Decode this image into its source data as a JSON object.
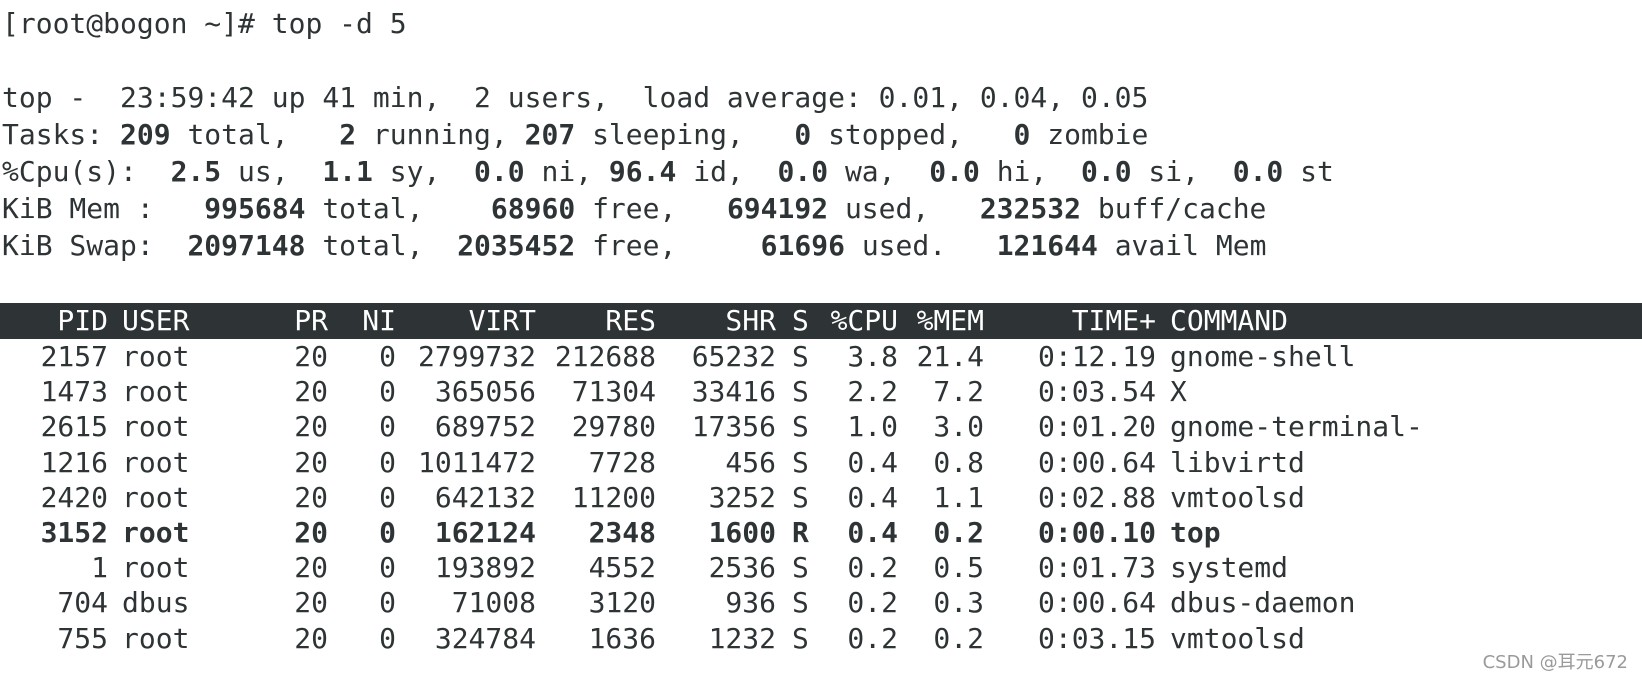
{
  "terminal": {
    "prompt_user_host": "[root@bogon ~]#",
    "command": "top -d 5"
  },
  "summary": {
    "uptime_label": "top -",
    "time": "23:59:42",
    "up_label": "up",
    "uptime_value": "41 min,",
    "users_count": "2",
    "users_label": "users,",
    "load_label": "load average:",
    "load_1": "0.01,",
    "load_5": "0.04,",
    "load_15": "0.05",
    "tasks_label": "Tasks:",
    "tasks_total": "209",
    "tasks_total_label": "total,",
    "tasks_running": "2",
    "tasks_running_label": "running,",
    "tasks_sleeping": "207",
    "tasks_sleeping_label": "sleeping,",
    "tasks_stopped": "0",
    "tasks_stopped_label": "stopped,",
    "tasks_zombie": "0",
    "tasks_zombie_label": "zombie",
    "cpu_label": "%Cpu(s):",
    "cpu_us": "2.5",
    "cpu_us_label": "us,",
    "cpu_sy": "1.1",
    "cpu_sy_label": "sy,",
    "cpu_ni": "0.0",
    "cpu_ni_label": "ni,",
    "cpu_id": "96.4",
    "cpu_id_label": "id,",
    "cpu_wa": "0.0",
    "cpu_wa_label": "wa,",
    "cpu_hi": "0.0",
    "cpu_hi_label": "hi,",
    "cpu_si": "0.0",
    "cpu_si_label": "si,",
    "cpu_st": "0.0",
    "cpu_st_label": "st",
    "mem_label": "KiB Mem :",
    "mem_total": "995684",
    "mem_total_label": "total,",
    "mem_free": "68960",
    "mem_free_label": "free,",
    "mem_used": "694192",
    "mem_used_label": "used,",
    "mem_buff": "232532",
    "mem_buff_label": "buff/cache",
    "swap_label": "KiB Swap:",
    "swap_total": "2097148",
    "swap_total_label": "total,",
    "swap_free": "2035452",
    "swap_free_label": "free,",
    "swap_used": "61696",
    "swap_used_label": "used.",
    "swap_avail": "121644",
    "swap_avail_label": "avail Mem"
  },
  "process_table": {
    "columns": [
      "PID",
      "USER",
      "PR",
      "NI",
      "VIRT",
      "RES",
      "SHR",
      "S",
      "%CPU",
      "%MEM",
      "TIME+",
      "COMMAND"
    ],
    "rows": [
      {
        "pid": "2157",
        "user": "root",
        "pr": "20",
        "ni": "0",
        "virt": "2799732",
        "res": "212688",
        "shr": "65232",
        "s": "S",
        "cpu": "3.8",
        "mem": "21.4",
        "time": "0:12.19",
        "command": "gnome-shell",
        "highlight": false
      },
      {
        "pid": "1473",
        "user": "root",
        "pr": "20",
        "ni": "0",
        "virt": "365056",
        "res": "71304",
        "shr": "33416",
        "s": "S",
        "cpu": "2.2",
        "mem": "7.2",
        "time": "0:03.54",
        "command": "X",
        "highlight": false
      },
      {
        "pid": "2615",
        "user": "root",
        "pr": "20",
        "ni": "0",
        "virt": "689752",
        "res": "29780",
        "shr": "17356",
        "s": "S",
        "cpu": "1.0",
        "mem": "3.0",
        "time": "0:01.20",
        "command": "gnome-terminal-",
        "highlight": false
      },
      {
        "pid": "1216",
        "user": "root",
        "pr": "20",
        "ni": "0",
        "virt": "1011472",
        "res": "7728",
        "shr": "456",
        "s": "S",
        "cpu": "0.4",
        "mem": "0.8",
        "time": "0:00.64",
        "command": "libvirtd",
        "highlight": false
      },
      {
        "pid": "2420",
        "user": "root",
        "pr": "20",
        "ni": "0",
        "virt": "642132",
        "res": "11200",
        "shr": "3252",
        "s": "S",
        "cpu": "0.4",
        "mem": "1.1",
        "time": "0:02.88",
        "command": "vmtoolsd",
        "highlight": false
      },
      {
        "pid": "3152",
        "user": "root",
        "pr": "20",
        "ni": "0",
        "virt": "162124",
        "res": "2348",
        "shr": "1600",
        "s": "R",
        "cpu": "0.4",
        "mem": "0.2",
        "time": "0:00.10",
        "command": "top",
        "highlight": true
      },
      {
        "pid": "1",
        "user": "root",
        "pr": "20",
        "ni": "0",
        "virt": "193892",
        "res": "4552",
        "shr": "2536",
        "s": "S",
        "cpu": "0.2",
        "mem": "0.5",
        "time": "0:01.73",
        "command": "systemd",
        "highlight": false
      },
      {
        "pid": "704",
        "user": "dbus",
        "pr": "20",
        "ni": "0",
        "virt": "71008",
        "res": "3120",
        "shr": "936",
        "s": "S",
        "cpu": "0.2",
        "mem": "0.3",
        "time": "0:00.64",
        "command": "dbus-daemon",
        "highlight": false
      },
      {
        "pid": "755",
        "user": "root",
        "pr": "20",
        "ni": "0",
        "virt": "324784",
        "res": "1636",
        "shr": "1232",
        "s": "S",
        "cpu": "0.2",
        "mem": "0.2",
        "time": "0:03.15",
        "command": "vmtoolsd",
        "highlight": false
      }
    ]
  },
  "watermark": "CSDN @耳元672",
  "colors": {
    "text": "#2e3436",
    "header_bg": "#2e3436",
    "header_text": "#ffffff",
    "background": "#ffffff"
  }
}
